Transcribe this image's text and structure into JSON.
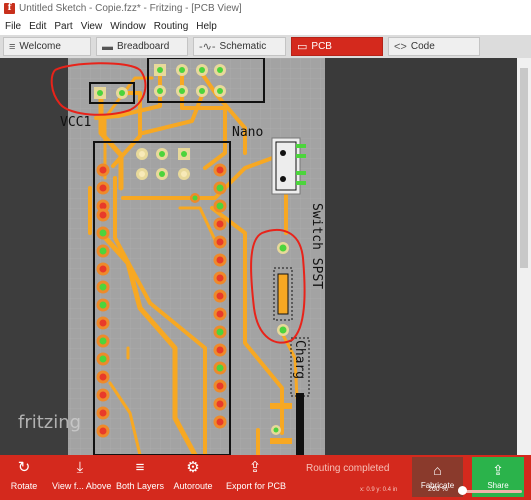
{
  "window": {
    "title": "Untitled Sketch - Copie.fzz* - Fritzing - [PCB View]",
    "app_icon_glyph": "f"
  },
  "menu": [
    "File",
    "Edit",
    "Part",
    "View",
    "Window",
    "Routing",
    "Help"
  ],
  "tabs": [
    {
      "label": "Welcome",
      "icon": "≡"
    },
    {
      "label": "Breadboard",
      "icon": "▬"
    },
    {
      "label": "Schematic",
      "icon": "-∿-"
    },
    {
      "label": "PCB",
      "icon": "▭",
      "active": true
    },
    {
      "label": "Code",
      "icon": "<>"
    }
  ],
  "pcb": {
    "labels": {
      "vcc": "VCC1",
      "nano": "Nano",
      "switch": "Switch SPST",
      "charge": "Charg"
    },
    "watermark": "fritzing",
    "colors": {
      "board": "#a3a3a3",
      "trace": "#f7a823",
      "pad_green": "#4cd43c",
      "pad_red": "#e83a2a",
      "annotation": "#e8231a"
    }
  },
  "toolbar": {
    "tools": [
      {
        "label": "Rotate",
        "icon": "↻"
      },
      {
        "label": "View f... Above",
        "icon": "⤓"
      },
      {
        "label": "Both Layers",
        "icon": "≡"
      },
      {
        "label": "Autoroute",
        "icon": "⚙"
      },
      {
        "label": "Export for PCB",
        "icon": "⇪"
      }
    ],
    "status": "Routing completed",
    "fabricate": {
      "label": "Fabricate",
      "icon": "⌂"
    },
    "share": {
      "label": "Share",
      "icon": "⇪"
    },
    "zoom": "260 %",
    "coords": "x: 0.9 y: 0.4 in"
  }
}
